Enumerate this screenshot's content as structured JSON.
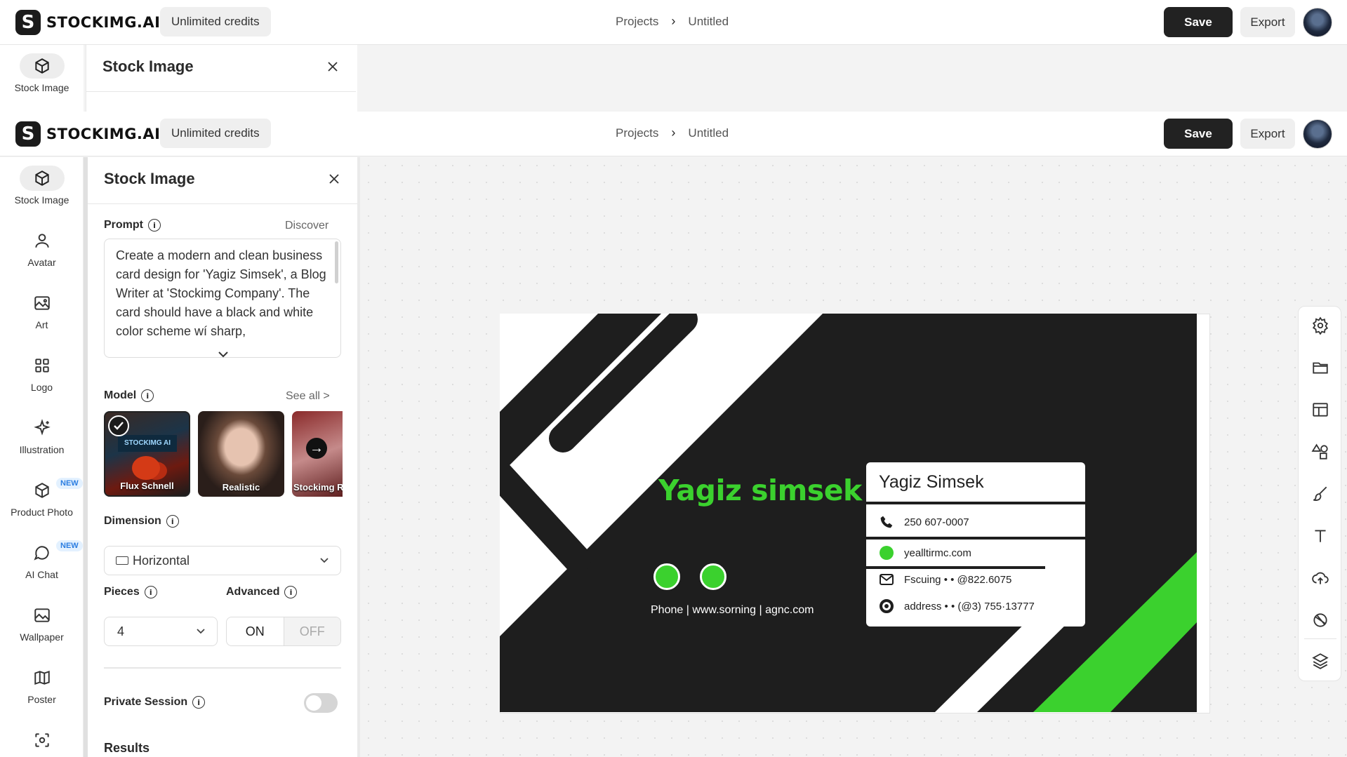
{
  "header": {
    "brand": "STOCKIMG.AI",
    "logo_letter": "S",
    "credits": "Unlimited credits",
    "breadcrumb": [
      "Projects",
      "Untitled"
    ],
    "breadcrumb_sep": "›",
    "save": "Save",
    "export": "Export"
  },
  "rail": {
    "items": [
      {
        "label": "Stock Image",
        "icon": "cube-icon",
        "active": true
      },
      {
        "label": "Avatar",
        "icon": "person-icon"
      },
      {
        "label": "Art",
        "icon": "image-icon"
      },
      {
        "label": "Logo",
        "icon": "grid-icon"
      },
      {
        "label": "Illustration",
        "icon": "sparkle-icon"
      },
      {
        "label": "Product Photo",
        "icon": "box-icon",
        "badge": "NEW"
      },
      {
        "label": "AI Chat",
        "icon": "chat-icon",
        "badge": "NEW"
      },
      {
        "label": "Wallpaper",
        "icon": "wallpaper-icon"
      },
      {
        "label": "Poster",
        "icon": "map-icon"
      }
    ]
  },
  "panel": {
    "title": "Stock Image",
    "prompt_label": "Prompt",
    "discover": "Discover",
    "prompt_text": "Create a modern and clean business card design for 'Yagiz Simsek', a Blog Writer at 'Stockimg Company'. The card should have a black and white color scheme wí sharp,",
    "model_label": "Model",
    "see_all": "See all >",
    "models": [
      {
        "name": "Flux Schnell",
        "selected": true,
        "sign_text": "STOCKIMG AI"
      },
      {
        "name": "Realistic"
      },
      {
        "name": "Stockimg R"
      }
    ],
    "dimension_label": "Dimension",
    "dimension_value": "Horizontal",
    "pieces_label": "Pieces",
    "pieces_value": "4",
    "advanced_label": "Advanced",
    "advanced_on": "ON",
    "advanced_off": "OFF",
    "private_label": "Private Session",
    "private_enabled": false,
    "results_label": "Results"
  },
  "card": {
    "big_name": "Yagiz simsek",
    "contact_line": "Phone | www.sorning | agnc.com",
    "info_name": "Yagiz Simsek",
    "rows": [
      "250 607-0007",
      "yealltirmc.com",
      "Fscuing • • @822.6075",
      "address • • (@3) 755·13777"
    ],
    "accent": "#3bd12e",
    "dark": "#1e1e1e"
  },
  "right_tools": [
    "settings-icon",
    "folder-icon",
    "layout-icon",
    "shapes-icon",
    "brush-icon",
    "text-icon",
    "upload-icon",
    "sticker-icon",
    "layers-icon"
  ]
}
